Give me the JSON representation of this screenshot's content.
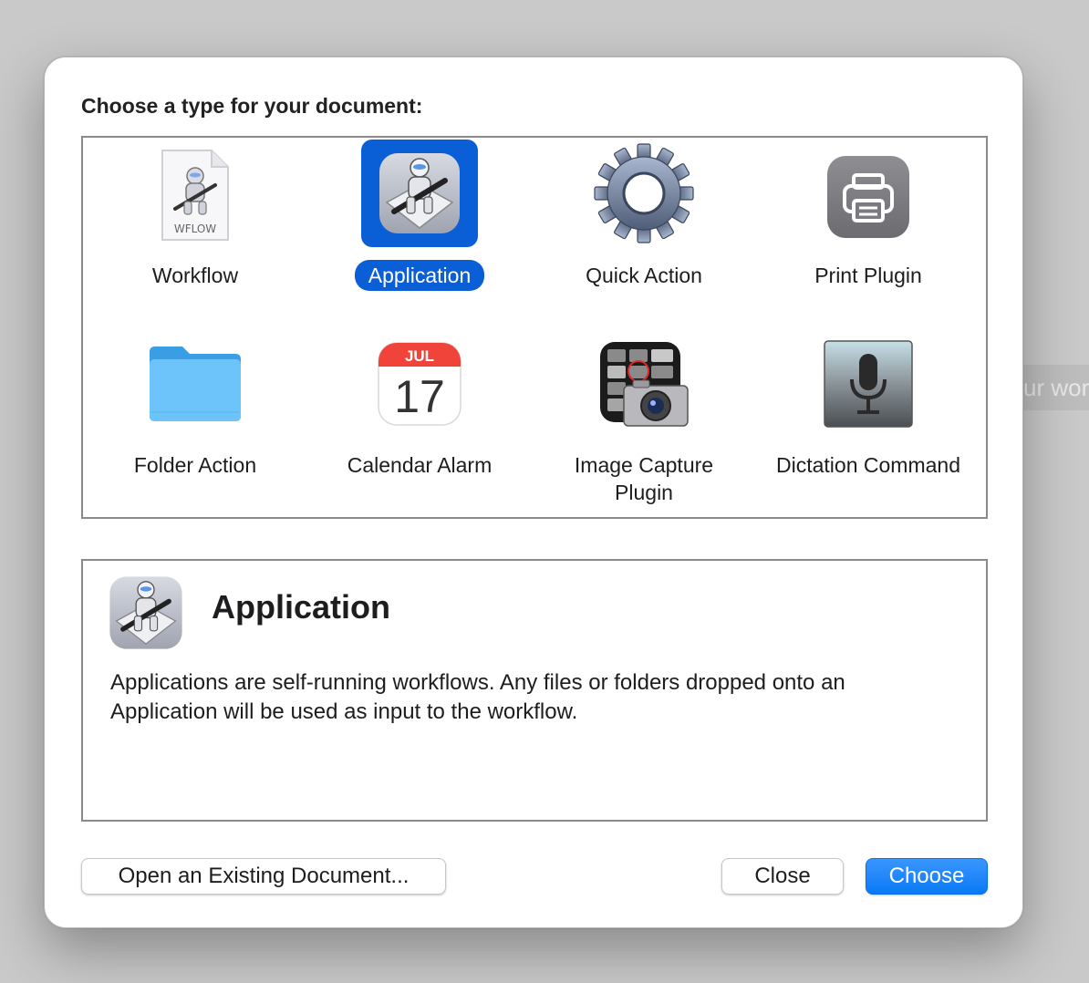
{
  "background": {
    "ghost_text": "ur worl"
  },
  "dialog": {
    "prompt": "Choose a type for your document:",
    "types": [
      {
        "label": "Workflow",
        "icon": "workflow-document-icon",
        "badge": "WFLOW",
        "selected": false
      },
      {
        "label": "Application",
        "icon": "automator-robot-icon",
        "selected": true
      },
      {
        "label": "Quick Action",
        "icon": "gear-icon",
        "selected": false
      },
      {
        "label": "Print Plugin",
        "icon": "printer-icon",
        "selected": false
      },
      {
        "label": "Folder Action",
        "icon": "folder-icon",
        "selected": false
      },
      {
        "label": "Calendar Alarm",
        "icon": "calendar-icon",
        "month": "JUL",
        "day": "17",
        "selected": false
      },
      {
        "label": "Image Capture Plugin",
        "icon": "camera-icon",
        "selected": false
      },
      {
        "label": "Dictation Command",
        "icon": "microphone-icon",
        "selected": false
      }
    ],
    "description": {
      "icon": "automator-robot-icon",
      "title": "Application",
      "text": "Applications are self-running workflows. Any files or folders dropped onto an Application will be used as input to the workflow."
    },
    "buttons": {
      "open_existing": "Open an Existing Document...",
      "close": "Close",
      "choose": "Choose"
    },
    "colors": {
      "accent": "#0a5fd7",
      "button_blue": "#0a79f5"
    }
  }
}
